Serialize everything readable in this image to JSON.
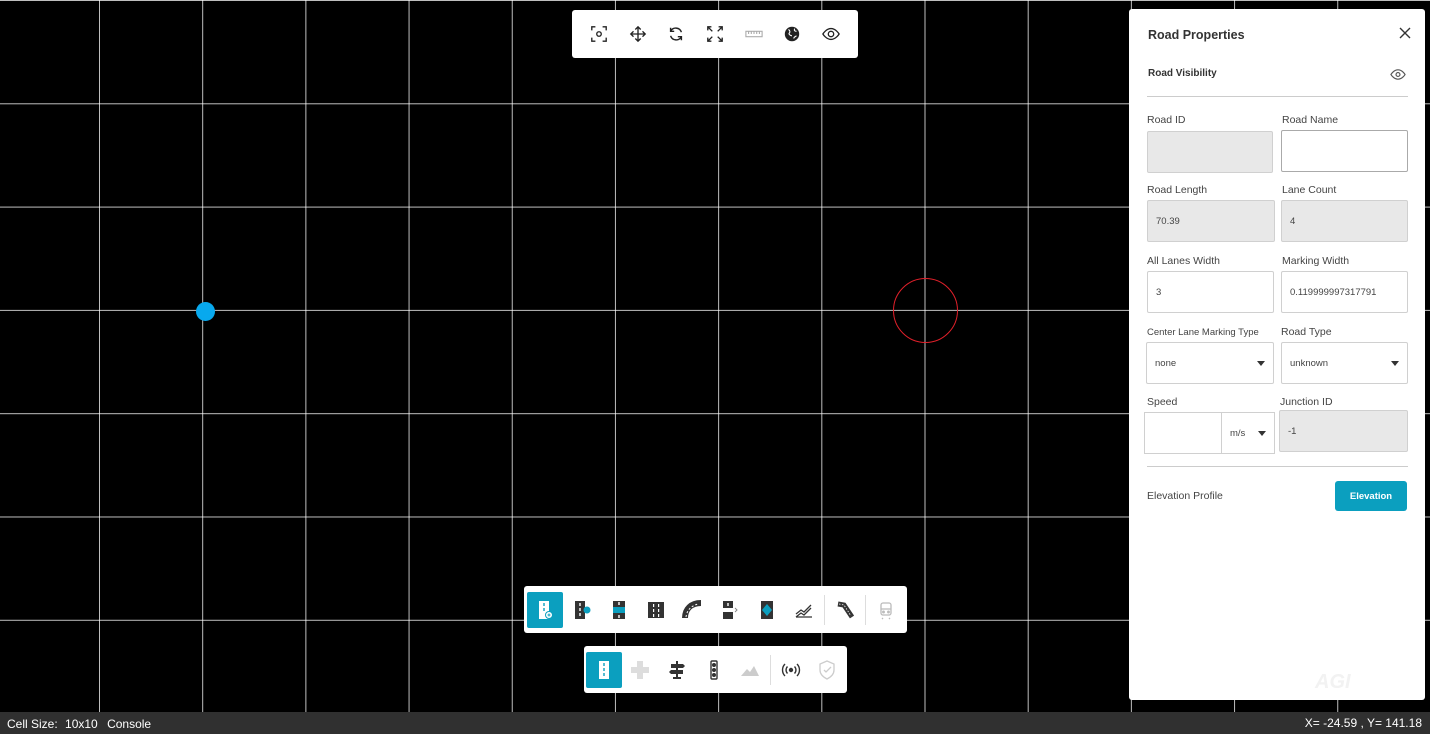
{
  "panel": {
    "title": "Road Properties",
    "visibility_label": "Road Visibility",
    "fields": {
      "road_id": {
        "label": "Road ID",
        "value": ""
      },
      "road_name": {
        "label": "Road Name",
        "value": ""
      },
      "road_length": {
        "label": "Road Length",
        "value": "70.39"
      },
      "lane_count": {
        "label": "Lane Count",
        "value": "4"
      },
      "all_lanes_width": {
        "label": "All Lanes Width",
        "value": "3"
      },
      "marking_width": {
        "label": "Marking Width",
        "value": "0.119999997317791"
      },
      "center_lane_marking_type": {
        "label": "Center Lane Marking Type",
        "value": "none"
      },
      "road_type": {
        "label": "Road Type",
        "value": "unknown"
      },
      "speed": {
        "label": "Speed",
        "value": "",
        "unit": "m/s"
      },
      "junction_id": {
        "label": "Junction ID",
        "value": "-1"
      }
    },
    "elevation_label": "Elevation Profile",
    "elevation_button": "Elevation",
    "watermark": "AGI"
  },
  "top_toolbar": {
    "icons": [
      "focus-icon",
      "move-icon",
      "rotate-icon",
      "fit-icon",
      "ruler-icon",
      "globe-icon",
      "eye-icon"
    ]
  },
  "bottom_toolbar_1": {
    "icons": [
      "road-add-icon",
      "road-extend-icon",
      "lane-icon",
      "multi-lane-icon",
      "curve-road-icon",
      "lane-marking-icon",
      "road-marking-icon",
      "elevation-line-icon",
      "road-cut-icon",
      "vehicle-icon"
    ],
    "active_index": 0
  },
  "bottom_toolbar_2": {
    "icons": [
      "road-tool-icon",
      "junction-icon",
      "signpost-icon",
      "traffic-light-icon",
      "terrain-icon",
      "signal-icon",
      "shield-icon"
    ],
    "active_index": 0
  },
  "status": {
    "cell_size_label": "Cell Size:",
    "cell_size_value": "10x10",
    "console_label": "Console",
    "coords": "X= -24.59 , Y= 141.18"
  },
  "colors": {
    "accent": "#0b9fbf",
    "marker_blue": "#08a9ee",
    "marker_red": "#e0202a"
  }
}
